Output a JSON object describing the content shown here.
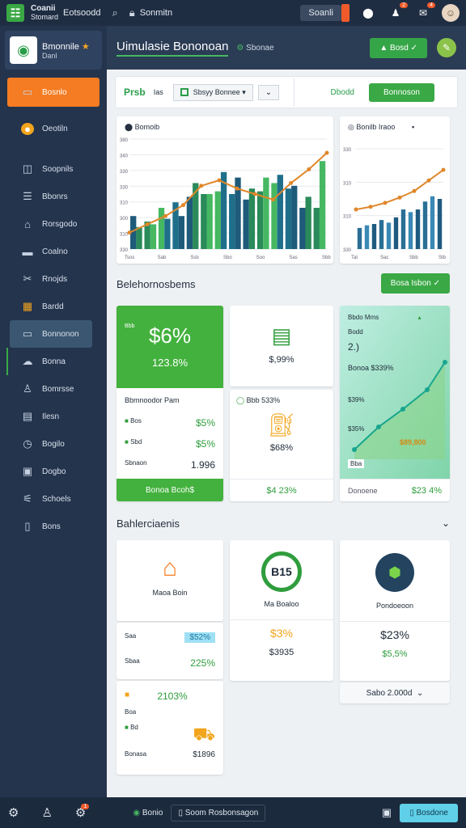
{
  "topbar": {
    "app_line1": "Coanii",
    "app_line2": "Stomard",
    "name": "Eotsoodd",
    "selector": "Sonmitn",
    "search": "Soanli"
  },
  "sidebar": {
    "brand_title": "Bmonnile",
    "brand_sub": "Danl",
    "items": [
      {
        "label": "Bosnlo",
        "icon": "store-icon"
      },
      {
        "label": "Oeotiln",
        "icon": "coin-icon"
      },
      {
        "label": "Soopnils",
        "icon": "database-icon"
      },
      {
        "label": "Bbonrs",
        "icon": "list-icon"
      },
      {
        "label": "Rorsgodo",
        "icon": "home-icon"
      },
      {
        "label": "Coalno",
        "icon": "card-icon"
      },
      {
        "label": "Rnojds",
        "icon": "tools-icon"
      },
      {
        "label": "Bardd",
        "icon": "grid-icon"
      },
      {
        "label": "Bonnonon",
        "icon": "monitor-icon"
      },
      {
        "label": "Bonna",
        "icon": "cloud-icon"
      },
      {
        "label": "Bomrsse",
        "icon": "user-icon"
      },
      {
        "label": "Ilesn",
        "icon": "table-icon"
      },
      {
        "label": "Bogilo",
        "icon": "clock-icon"
      },
      {
        "label": "Dogbo",
        "icon": "save-icon"
      },
      {
        "label": "Schoels",
        "icon": "chart-icon"
      },
      {
        "label": "Bons",
        "icon": "doc-icon"
      }
    ]
  },
  "header": {
    "title": "Uimulasie Bononoan",
    "sub": "Sbonae",
    "button": "Bosd"
  },
  "filter": {
    "label": "Prsb",
    "small": "Ias",
    "select": "Sbsyy Bonnee",
    "right_label": "Dbodd",
    "right_button": "Bonnoson"
  },
  "chart1": {
    "title": "Bomoib",
    "yticks": [
      "380",
      "340",
      "330",
      "330",
      "310",
      "300",
      "310",
      "330"
    ],
    "xticks": [
      "Tsos",
      "Sab",
      "Ssb",
      "Sbo",
      "Soo",
      "Sas",
      "Sbb"
    ]
  },
  "chart2": {
    "title": "Bonilb Iraoo",
    "yticks": [
      "330",
      "310",
      "310",
      "330"
    ],
    "xticks": [
      "Tat",
      "Sac",
      "Sbb",
      "Stb"
    ]
  },
  "chart_data": [
    {
      "type": "bar",
      "title": "Bomoib",
      "series": [
        {
          "name": "",
          "values": [
            120,
            100,
            150,
            170,
            190,
            200,
            210,
            200,
            180,
            210,
            240,
            220,
            150,
            150
          ]
        },
        {
          "name": "",
          "values": [
            80,
            90,
            110,
            120,
            240,
            200,
            280,
            260,
            220,
            260,
            270,
            230,
            190,
            320
          ]
        }
      ],
      "line": [
        60,
        90,
        120,
        160,
        230,
        250,
        220,
        200,
        180,
        240,
        290,
        350
      ],
      "ylim": [
        0,
        400
      ]
    },
    {
      "type": "bar",
      "title": "Bonilb Iraoo",
      "series": [
        {
          "name": "",
          "values": [
            80,
            90,
            95,
            110,
            100,
            120,
            150,
            140,
            150,
            180,
            200,
            190
          ]
        }
      ],
      "line": [
        150,
        160,
        175,
        195,
        220,
        260,
        300
      ],
      "ylim": [
        0,
        380
      ]
    }
  ],
  "sect1": {
    "title": "Belehornosbems",
    "button": "Bosa Isbon"
  },
  "kpis": {
    "k1": {
      "top_small": "Bbb",
      "big": "$6%",
      "pct": "123.8%",
      "sub": "Bbmnoodor Pam",
      "r1": "Bos",
      "r1v": "$5%",
      "r2": "Sbd",
      "r2v": "$5%",
      "r3": "Sbnaon",
      "r3v": "1.996",
      "foot": "Bonoa Bcoh$"
    },
    "k2": {
      "pct": "$,99%",
      "sub": "Bbb 533%",
      "val": "$68%",
      "foot": "$4 23%"
    },
    "k3": {
      "t1": "Bbdo Mms",
      "t2": "Bodd",
      "t3": "2.)",
      "v1": "Bonoa $339%",
      "v2": "$39%",
      "v3": "$35%",
      "v4": "$89,800",
      "label": "Bba",
      "foot_l": "Donoene",
      "foot_r": "$23 4%"
    }
  },
  "sect2": {
    "title": "Bahlerciaenis"
  },
  "cards": {
    "c1": {
      "name": "Maoa Boin",
      "a": "Saa",
      "av": "$52%",
      "b": "Sbaa",
      "bv": "225%",
      "c": "2103%",
      "d": "Boa",
      "e": "Bd",
      "f": "Bonasa",
      "fv": "$1896"
    },
    "c2": {
      "logo": "B15",
      "name": "Ma Boaloo",
      "v1": "$3%",
      "v2": "$3935"
    },
    "c3": {
      "name": "Pondoeoon",
      "v1": "$23%",
      "v2": "$5,5%",
      "select": "Sabo 2.000d"
    }
  },
  "bottom": {
    "a": "Bonio",
    "b": "Soom Rosbonsagon",
    "c": "Bosdone"
  }
}
